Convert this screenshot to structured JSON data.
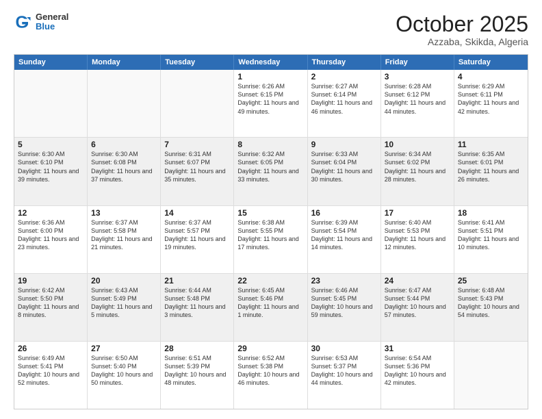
{
  "header": {
    "logo_general": "General",
    "logo_blue": "Blue",
    "month": "October 2025",
    "location": "Azzaba, Skikda, Algeria"
  },
  "weekdays": [
    "Sunday",
    "Monday",
    "Tuesday",
    "Wednesday",
    "Thursday",
    "Friday",
    "Saturday"
  ],
  "rows": [
    [
      {
        "day": "",
        "text": "",
        "empty": true
      },
      {
        "day": "",
        "text": "",
        "empty": true
      },
      {
        "day": "",
        "text": "",
        "empty": true
      },
      {
        "day": "1",
        "text": "Sunrise: 6:26 AM\nSunset: 6:15 PM\nDaylight: 11 hours\nand 49 minutes."
      },
      {
        "day": "2",
        "text": "Sunrise: 6:27 AM\nSunset: 6:14 PM\nDaylight: 11 hours\nand 46 minutes."
      },
      {
        "day": "3",
        "text": "Sunrise: 6:28 AM\nSunset: 6:12 PM\nDaylight: 11 hours\nand 44 minutes."
      },
      {
        "day": "4",
        "text": "Sunrise: 6:29 AM\nSunset: 6:11 PM\nDaylight: 11 hours\nand 42 minutes."
      }
    ],
    [
      {
        "day": "5",
        "text": "Sunrise: 6:30 AM\nSunset: 6:10 PM\nDaylight: 11 hours\nand 39 minutes.",
        "shaded": true
      },
      {
        "day": "6",
        "text": "Sunrise: 6:30 AM\nSunset: 6:08 PM\nDaylight: 11 hours\nand 37 minutes.",
        "shaded": true
      },
      {
        "day": "7",
        "text": "Sunrise: 6:31 AM\nSunset: 6:07 PM\nDaylight: 11 hours\nand 35 minutes.",
        "shaded": true
      },
      {
        "day": "8",
        "text": "Sunrise: 6:32 AM\nSunset: 6:05 PM\nDaylight: 11 hours\nand 33 minutes.",
        "shaded": true
      },
      {
        "day": "9",
        "text": "Sunrise: 6:33 AM\nSunset: 6:04 PM\nDaylight: 11 hours\nand 30 minutes.",
        "shaded": true
      },
      {
        "day": "10",
        "text": "Sunrise: 6:34 AM\nSunset: 6:02 PM\nDaylight: 11 hours\nand 28 minutes.",
        "shaded": true
      },
      {
        "day": "11",
        "text": "Sunrise: 6:35 AM\nSunset: 6:01 PM\nDaylight: 11 hours\nand 26 minutes.",
        "shaded": true
      }
    ],
    [
      {
        "day": "12",
        "text": "Sunrise: 6:36 AM\nSunset: 6:00 PM\nDaylight: 11 hours\nand 23 minutes."
      },
      {
        "day": "13",
        "text": "Sunrise: 6:37 AM\nSunset: 5:58 PM\nDaylight: 11 hours\nand 21 minutes."
      },
      {
        "day": "14",
        "text": "Sunrise: 6:37 AM\nSunset: 5:57 PM\nDaylight: 11 hours\nand 19 minutes."
      },
      {
        "day": "15",
        "text": "Sunrise: 6:38 AM\nSunset: 5:55 PM\nDaylight: 11 hours\nand 17 minutes."
      },
      {
        "day": "16",
        "text": "Sunrise: 6:39 AM\nSunset: 5:54 PM\nDaylight: 11 hours\nand 14 minutes."
      },
      {
        "day": "17",
        "text": "Sunrise: 6:40 AM\nSunset: 5:53 PM\nDaylight: 11 hours\nand 12 minutes."
      },
      {
        "day": "18",
        "text": "Sunrise: 6:41 AM\nSunset: 5:51 PM\nDaylight: 11 hours\nand 10 minutes."
      }
    ],
    [
      {
        "day": "19",
        "text": "Sunrise: 6:42 AM\nSunset: 5:50 PM\nDaylight: 11 hours\nand 8 minutes.",
        "shaded": true
      },
      {
        "day": "20",
        "text": "Sunrise: 6:43 AM\nSunset: 5:49 PM\nDaylight: 11 hours\nand 5 minutes.",
        "shaded": true
      },
      {
        "day": "21",
        "text": "Sunrise: 6:44 AM\nSunset: 5:48 PM\nDaylight: 11 hours\nand 3 minutes.",
        "shaded": true
      },
      {
        "day": "22",
        "text": "Sunrise: 6:45 AM\nSunset: 5:46 PM\nDaylight: 11 hours\nand 1 minute.",
        "shaded": true
      },
      {
        "day": "23",
        "text": "Sunrise: 6:46 AM\nSunset: 5:45 PM\nDaylight: 10 hours\nand 59 minutes.",
        "shaded": true
      },
      {
        "day": "24",
        "text": "Sunrise: 6:47 AM\nSunset: 5:44 PM\nDaylight: 10 hours\nand 57 minutes.",
        "shaded": true
      },
      {
        "day": "25",
        "text": "Sunrise: 6:48 AM\nSunset: 5:43 PM\nDaylight: 10 hours\nand 54 minutes.",
        "shaded": true
      }
    ],
    [
      {
        "day": "26",
        "text": "Sunrise: 6:49 AM\nSunset: 5:41 PM\nDaylight: 10 hours\nand 52 minutes."
      },
      {
        "day": "27",
        "text": "Sunrise: 6:50 AM\nSunset: 5:40 PM\nDaylight: 10 hours\nand 50 minutes."
      },
      {
        "day": "28",
        "text": "Sunrise: 6:51 AM\nSunset: 5:39 PM\nDaylight: 10 hours\nand 48 minutes."
      },
      {
        "day": "29",
        "text": "Sunrise: 6:52 AM\nSunset: 5:38 PM\nDaylight: 10 hours\nand 46 minutes."
      },
      {
        "day": "30",
        "text": "Sunrise: 6:53 AM\nSunset: 5:37 PM\nDaylight: 10 hours\nand 44 minutes."
      },
      {
        "day": "31",
        "text": "Sunrise: 6:54 AM\nSunset: 5:36 PM\nDaylight: 10 hours\nand 42 minutes."
      },
      {
        "day": "",
        "text": "",
        "empty": true
      }
    ]
  ]
}
